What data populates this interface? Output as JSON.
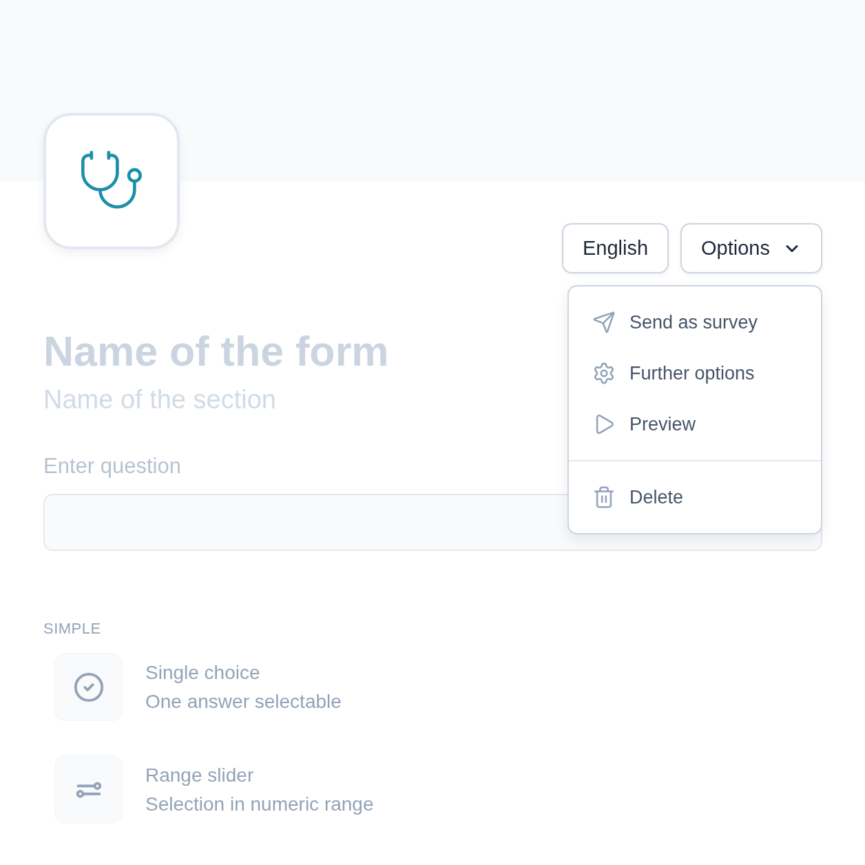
{
  "header": {
    "buttons": [
      {
        "label": "English",
        "dropdown": false
      },
      {
        "label": "Options",
        "dropdown": true
      }
    ]
  },
  "menu": {
    "groups": [
      [
        {
          "label": "Send as survey"
        },
        {
          "label": "Further options"
        },
        {
          "label": "Preview"
        }
      ],
      [
        {
          "label": "Delete"
        }
      ]
    ]
  },
  "form": {
    "title": "Name of the form",
    "section": "Name of the section",
    "question_label": "Enter question"
  },
  "question_types": {
    "heading": "SIMPLE",
    "items": [
      {
        "title": "Single choice",
        "description": "One answer selectable"
      },
      {
        "title": "Range slider",
        "description": "Selection in numeric range"
      }
    ]
  }
}
